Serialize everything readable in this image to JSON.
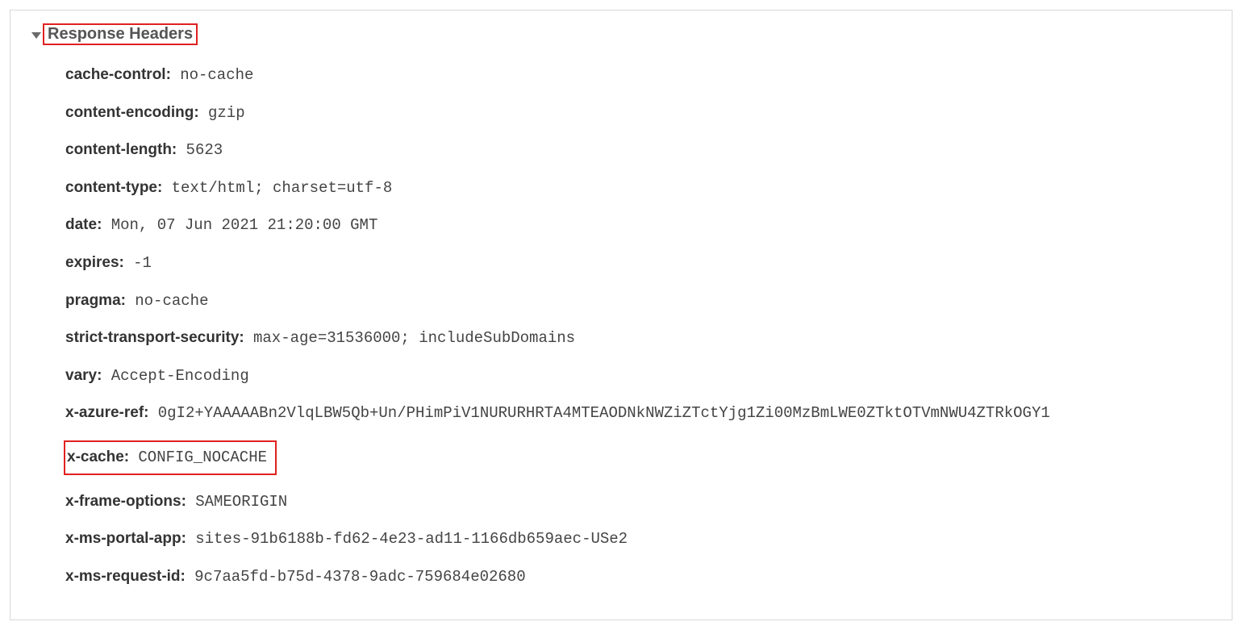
{
  "section": {
    "title": "Response Headers"
  },
  "headers": {
    "cache_control": {
      "name": "cache-control:",
      "value": "no-cache"
    },
    "content_encoding": {
      "name": "content-encoding:",
      "value": "gzip"
    },
    "content_length": {
      "name": "content-length:",
      "value": "5623"
    },
    "content_type": {
      "name": "content-type:",
      "value": "text/html; charset=utf-8"
    },
    "date": {
      "name": "date:",
      "value": "Mon, 07 Jun 2021 21:20:00 GMT"
    },
    "expires": {
      "name": "expires:",
      "value": "-1"
    },
    "pragma": {
      "name": "pragma:",
      "value": "no-cache"
    },
    "strict_transport_security": {
      "name": "strict-transport-security:",
      "value": "max-age=31536000; includeSubDomains"
    },
    "vary": {
      "name": "vary:",
      "value": "Accept-Encoding"
    },
    "x_azure_ref": {
      "name": "x-azure-ref:",
      "value": "0gI2+YAAAAABn2VlqLBW5Qb+Un/PHimPiV1NURURHRTA4MTEAODNkNWZiZTctYjg1Zi00MzBmLWE0ZTktOTVmNWU4ZTRkOGY1"
    },
    "x_cache": {
      "name": "x-cache:",
      "value": "CONFIG_NOCACHE"
    },
    "x_frame_options": {
      "name": "x-frame-options:",
      "value": "SAMEORIGIN"
    },
    "x_ms_portal_app": {
      "name": "x-ms-portal-app:",
      "value": "sites-91b6188b-fd62-4e23-ad11-1166db659aec-USe2"
    },
    "x_ms_request_id": {
      "name": "x-ms-request-id:",
      "value": "9c7aa5fd-b75d-4378-9adc-759684e02680"
    }
  }
}
